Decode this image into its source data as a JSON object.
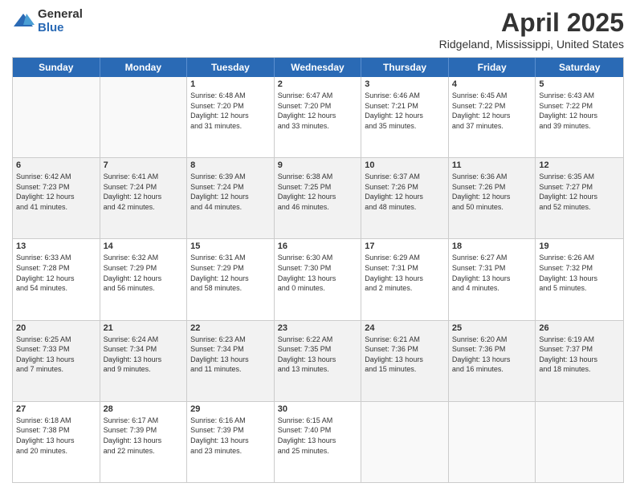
{
  "logo": {
    "general": "General",
    "blue": "Blue"
  },
  "title": {
    "month": "April 2025",
    "location": "Ridgeland, Mississippi, United States"
  },
  "weekdays": [
    "Sunday",
    "Monday",
    "Tuesday",
    "Wednesday",
    "Thursday",
    "Friday",
    "Saturday"
  ],
  "rows": [
    [
      {
        "day": "",
        "info": ""
      },
      {
        "day": "",
        "info": ""
      },
      {
        "day": "1",
        "info": "Sunrise: 6:48 AM\nSunset: 7:20 PM\nDaylight: 12 hours\nand 31 minutes."
      },
      {
        "day": "2",
        "info": "Sunrise: 6:47 AM\nSunset: 7:20 PM\nDaylight: 12 hours\nand 33 minutes."
      },
      {
        "day": "3",
        "info": "Sunrise: 6:46 AM\nSunset: 7:21 PM\nDaylight: 12 hours\nand 35 minutes."
      },
      {
        "day": "4",
        "info": "Sunrise: 6:45 AM\nSunset: 7:22 PM\nDaylight: 12 hours\nand 37 minutes."
      },
      {
        "day": "5",
        "info": "Sunrise: 6:43 AM\nSunset: 7:22 PM\nDaylight: 12 hours\nand 39 minutes."
      }
    ],
    [
      {
        "day": "6",
        "info": "Sunrise: 6:42 AM\nSunset: 7:23 PM\nDaylight: 12 hours\nand 41 minutes."
      },
      {
        "day": "7",
        "info": "Sunrise: 6:41 AM\nSunset: 7:24 PM\nDaylight: 12 hours\nand 42 minutes."
      },
      {
        "day": "8",
        "info": "Sunrise: 6:39 AM\nSunset: 7:24 PM\nDaylight: 12 hours\nand 44 minutes."
      },
      {
        "day": "9",
        "info": "Sunrise: 6:38 AM\nSunset: 7:25 PM\nDaylight: 12 hours\nand 46 minutes."
      },
      {
        "day": "10",
        "info": "Sunrise: 6:37 AM\nSunset: 7:26 PM\nDaylight: 12 hours\nand 48 minutes."
      },
      {
        "day": "11",
        "info": "Sunrise: 6:36 AM\nSunset: 7:26 PM\nDaylight: 12 hours\nand 50 minutes."
      },
      {
        "day": "12",
        "info": "Sunrise: 6:35 AM\nSunset: 7:27 PM\nDaylight: 12 hours\nand 52 minutes."
      }
    ],
    [
      {
        "day": "13",
        "info": "Sunrise: 6:33 AM\nSunset: 7:28 PM\nDaylight: 12 hours\nand 54 minutes."
      },
      {
        "day": "14",
        "info": "Sunrise: 6:32 AM\nSunset: 7:29 PM\nDaylight: 12 hours\nand 56 minutes."
      },
      {
        "day": "15",
        "info": "Sunrise: 6:31 AM\nSunset: 7:29 PM\nDaylight: 12 hours\nand 58 minutes."
      },
      {
        "day": "16",
        "info": "Sunrise: 6:30 AM\nSunset: 7:30 PM\nDaylight: 13 hours\nand 0 minutes."
      },
      {
        "day": "17",
        "info": "Sunrise: 6:29 AM\nSunset: 7:31 PM\nDaylight: 13 hours\nand 2 minutes."
      },
      {
        "day": "18",
        "info": "Sunrise: 6:27 AM\nSunset: 7:31 PM\nDaylight: 13 hours\nand 4 minutes."
      },
      {
        "day": "19",
        "info": "Sunrise: 6:26 AM\nSunset: 7:32 PM\nDaylight: 13 hours\nand 5 minutes."
      }
    ],
    [
      {
        "day": "20",
        "info": "Sunrise: 6:25 AM\nSunset: 7:33 PM\nDaylight: 13 hours\nand 7 minutes."
      },
      {
        "day": "21",
        "info": "Sunrise: 6:24 AM\nSunset: 7:34 PM\nDaylight: 13 hours\nand 9 minutes."
      },
      {
        "day": "22",
        "info": "Sunrise: 6:23 AM\nSunset: 7:34 PM\nDaylight: 13 hours\nand 11 minutes."
      },
      {
        "day": "23",
        "info": "Sunrise: 6:22 AM\nSunset: 7:35 PM\nDaylight: 13 hours\nand 13 minutes."
      },
      {
        "day": "24",
        "info": "Sunrise: 6:21 AM\nSunset: 7:36 PM\nDaylight: 13 hours\nand 15 minutes."
      },
      {
        "day": "25",
        "info": "Sunrise: 6:20 AM\nSunset: 7:36 PM\nDaylight: 13 hours\nand 16 minutes."
      },
      {
        "day": "26",
        "info": "Sunrise: 6:19 AM\nSunset: 7:37 PM\nDaylight: 13 hours\nand 18 minutes."
      }
    ],
    [
      {
        "day": "27",
        "info": "Sunrise: 6:18 AM\nSunset: 7:38 PM\nDaylight: 13 hours\nand 20 minutes."
      },
      {
        "day": "28",
        "info": "Sunrise: 6:17 AM\nSunset: 7:39 PM\nDaylight: 13 hours\nand 22 minutes."
      },
      {
        "day": "29",
        "info": "Sunrise: 6:16 AM\nSunset: 7:39 PM\nDaylight: 13 hours\nand 23 minutes."
      },
      {
        "day": "30",
        "info": "Sunrise: 6:15 AM\nSunset: 7:40 PM\nDaylight: 13 hours\nand 25 minutes."
      },
      {
        "day": "",
        "info": ""
      },
      {
        "day": "",
        "info": ""
      },
      {
        "day": "",
        "info": ""
      }
    ]
  ]
}
